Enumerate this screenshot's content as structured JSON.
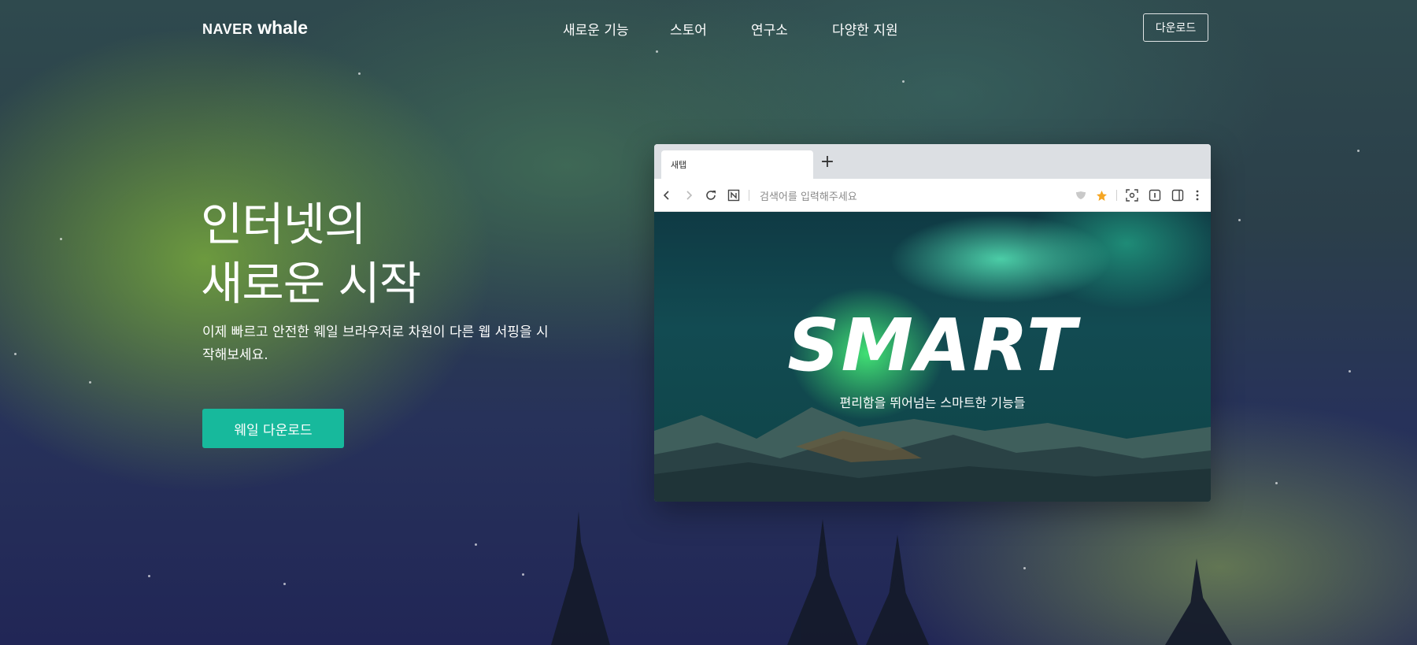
{
  "header": {
    "logo_naver": "NAVER",
    "logo_whale": "whale",
    "nav": [
      {
        "label": "새로운 기능"
      },
      {
        "label": "스토어"
      },
      {
        "label": "연구소"
      },
      {
        "label": "다양한 지원"
      }
    ],
    "download_label": "다운로드"
  },
  "hero": {
    "title_line1": "인터넷의",
    "title_line2": "새로운 시작",
    "description": "이제 빠르고 안전한 웨일 브라우저로 차원이 다른 웹 서핑을 시작해보세요.",
    "cta_label": "웨일 다운로드"
  },
  "browser_mockup": {
    "tab_label": "새탭",
    "new_tab_icon": "plus-icon",
    "address_placeholder": "검색어를 입력해주세요",
    "headline": "SMART",
    "subheadline": "편리함을 뛰어넘는 스마트한 기능들",
    "colors": {
      "star": "#f5a623"
    }
  },
  "colors": {
    "cta": "#17b99c"
  }
}
